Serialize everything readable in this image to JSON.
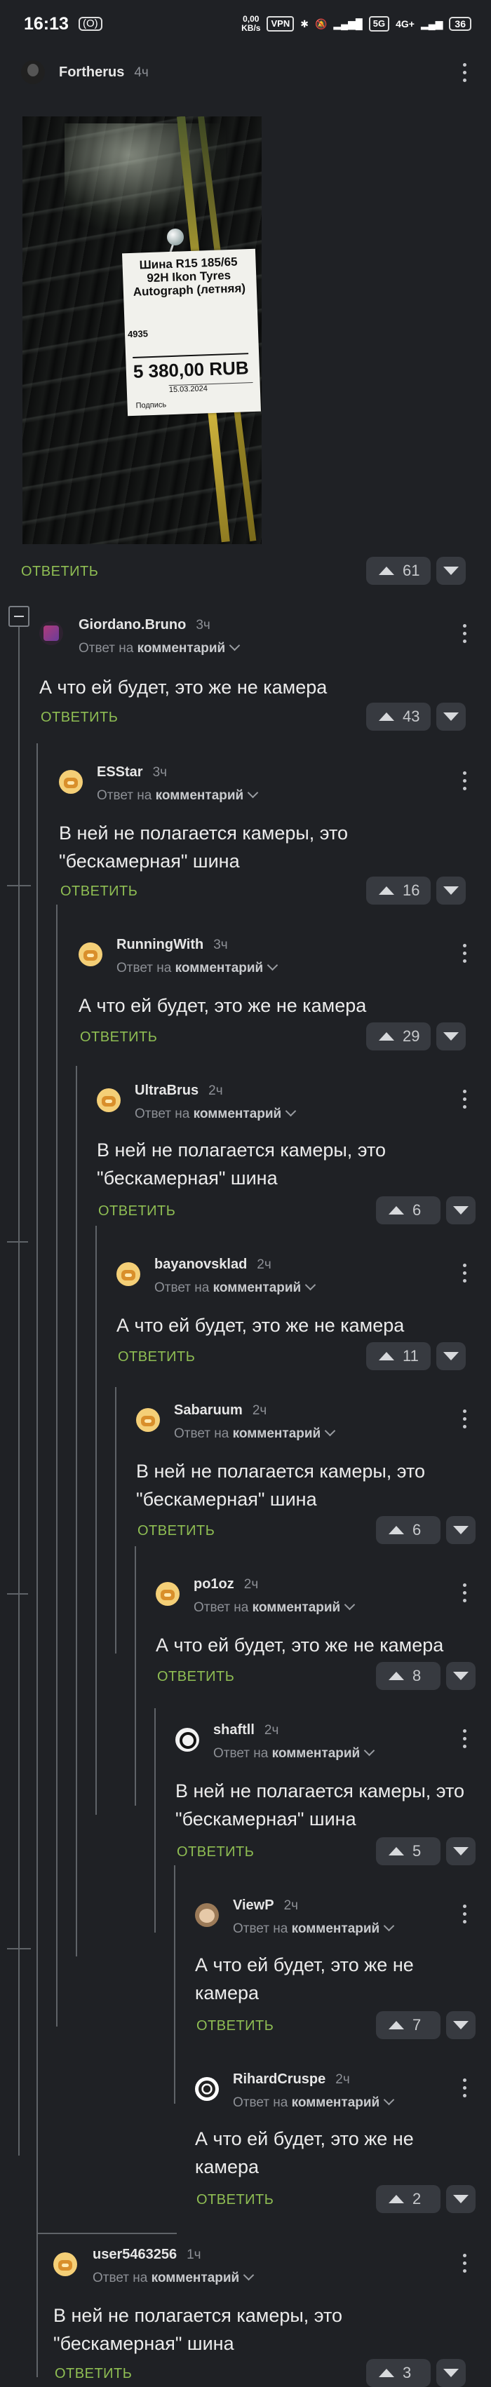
{
  "status_bar": {
    "time": "16:13",
    "left_badge": "(O)",
    "net_speed_top": "0,00",
    "net_speed_unit": "KB/s",
    "vpn": "VPN",
    "signal1": "5G",
    "signal2": "4G+",
    "battery": "36"
  },
  "ui": {
    "reply_prefix": "Ответ на",
    "reply_target": "комментарий",
    "answer_label": "ОТВЕТИТЬ"
  },
  "post": {
    "author": "Fortherus",
    "time": "4ч",
    "votes": "61",
    "image_label": {
      "title": "Шина R15 185/65 92H Ikon Tyres Autograph (летняя)",
      "code": "4935",
      "price": "5 380,00 RUB",
      "date": "15.03.2024",
      "sign": "Подпись"
    }
  },
  "comments": [
    {
      "author": "Giordano.Bruno",
      "time": "3ч",
      "text": "А что ей будет, это же не камера",
      "votes": "43"
    },
    {
      "author": "ESStar",
      "time": "3ч",
      "text": "В ней не полагается камеры, это \"бескамерная\" шина",
      "votes": "16"
    },
    {
      "author": "RunningWith",
      "time": "3ч",
      "text": "А что ей будет, это же не камера",
      "votes": "29"
    },
    {
      "author": "UltraBrus",
      "time": "2ч",
      "text": "В ней не полагается камеры, это \"бескамерная\" шина",
      "votes": "6"
    },
    {
      "author": "bayanovsklad",
      "time": "2ч",
      "text": "А что ей будет, это же не камера",
      "votes": "11"
    },
    {
      "author": "Sabaruum",
      "time": "2ч",
      "text": "В ней не полагается камеры, это \"бескамерная\" шина",
      "votes": "6"
    },
    {
      "author": "po1oz",
      "time": "2ч",
      "text": "А что ей будет, это же не камера",
      "votes": "8"
    },
    {
      "author": "shaftll",
      "time": "2ч",
      "text": "В ней не полагается камеры, это \"бескамерная\" шина",
      "votes": "5"
    },
    {
      "author": "ViewP",
      "time": "2ч",
      "text": "А что ей будет, это же не камера",
      "votes": "7"
    },
    {
      "author": "RihardCruspe",
      "time": "2ч",
      "text": "А что ей будет, это же не камера",
      "votes": "2"
    },
    {
      "author": "user5463256",
      "time": "1ч",
      "text": "В ней не полагается камеры, это \"бескамерная\" шина",
      "votes": "3"
    }
  ]
}
